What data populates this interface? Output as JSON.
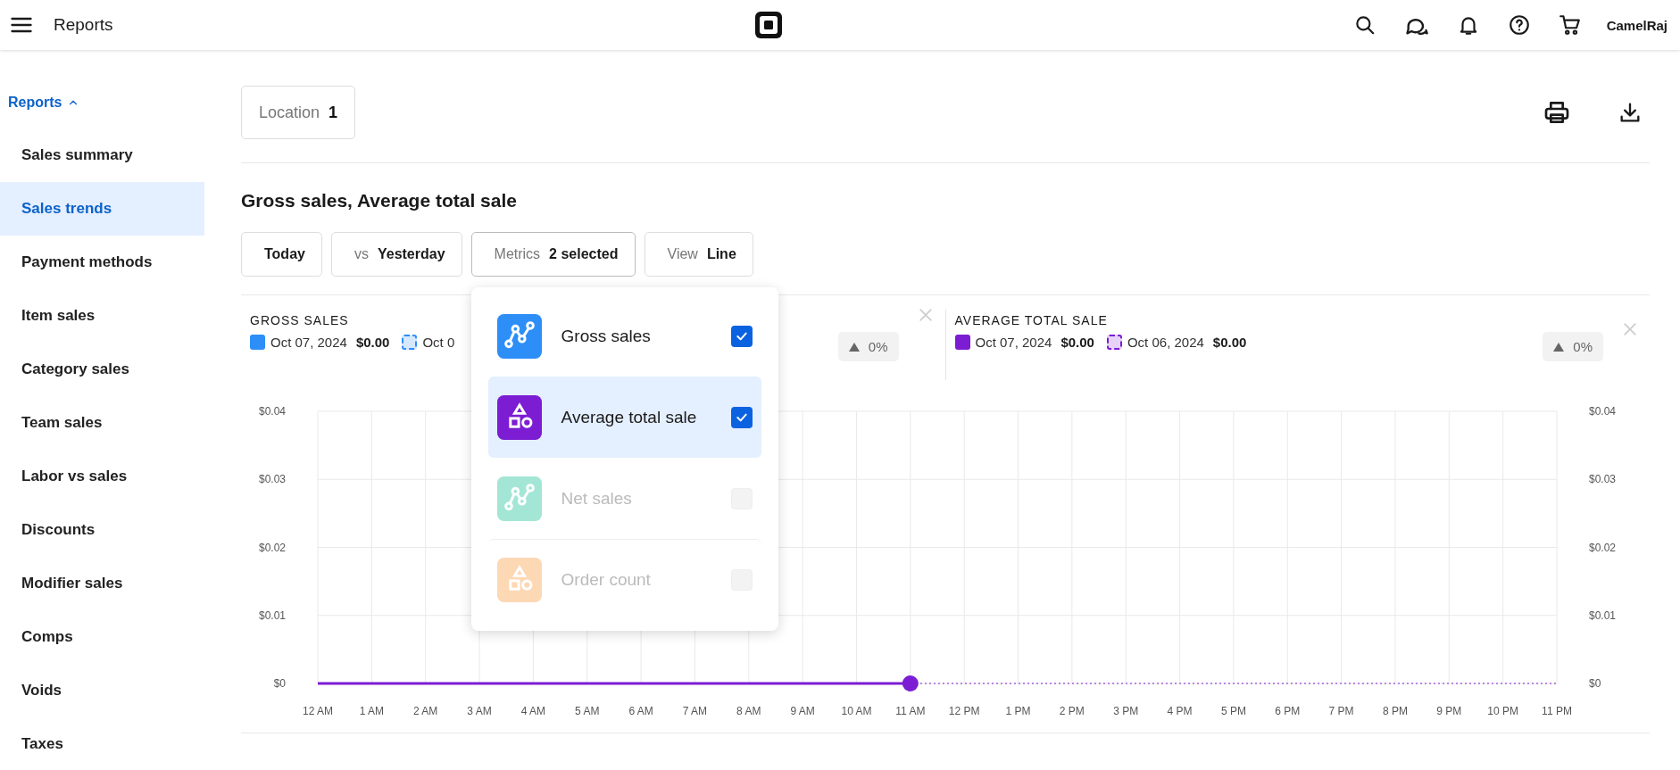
{
  "topbar": {
    "title": "Reports",
    "user": "CamelRaj"
  },
  "sidebar": {
    "section": {
      "label": "Reports",
      "expanded": true
    },
    "items": [
      {
        "label": "Sales summary",
        "selected": false
      },
      {
        "label": "Sales trends",
        "selected": true
      },
      {
        "label": "Payment methods",
        "selected": false
      },
      {
        "label": "Item sales",
        "selected": false
      },
      {
        "label": "Category sales",
        "selected": false
      },
      {
        "label": "Team sales",
        "selected": false
      },
      {
        "label": "Labor vs sales",
        "selected": false
      },
      {
        "label": "Discounts",
        "selected": false
      },
      {
        "label": "Modifier sales",
        "selected": false
      },
      {
        "label": "Comps",
        "selected": false
      },
      {
        "label": "Voids",
        "selected": false
      },
      {
        "label": "Taxes",
        "selected": false
      }
    ]
  },
  "location": {
    "label": "Location",
    "value": "1"
  },
  "report": {
    "title": "Gross sales, Average total sale",
    "filters": [
      {
        "value": "Today",
        "expanded": false
      },
      {
        "label": "vs",
        "value": "Yesterday",
        "expanded": false
      },
      {
        "label": "Metrics",
        "value": "2 selected",
        "expanded": true,
        "menu": [
          {
            "label": "Gross sales",
            "kind": "line",
            "color": "#2d8ef8",
            "checked": true,
            "disabled": false,
            "highlighted": false
          },
          {
            "label": "Average total sale",
            "kind": "shapes",
            "color": "#7c1dd3",
            "checked": true,
            "disabled": false,
            "highlighted": true
          },
          {
            "label": "Net sales",
            "kind": "line",
            "color": "#a3e6d5",
            "checked": false,
            "disabled": true,
            "highlighted": false
          },
          {
            "label": "Order count",
            "kind": "shapes",
            "color": "#fdd8b5",
            "checked": false,
            "disabled": true,
            "highlighted": false
          }
        ]
      },
      {
        "label": "View",
        "value": "Line",
        "expanded": false
      }
    ],
    "metric_cards": [
      {
        "title": "GROSS SALES",
        "color": "#2d8ef8",
        "legend": [
          {
            "kind": "current",
            "date": "Oct 07, 2024",
            "value": "$0.00"
          },
          {
            "kind": "previous",
            "date": "Oct 0"
          }
        ],
        "change": "0%"
      },
      {
        "title": "AVERAGE TOTAL SALE",
        "color": "#7c1dd3",
        "legend": [
          {
            "kind": "current",
            "date": "Oct 07, 2024",
            "value": "$0.00"
          },
          {
            "kind": "previous",
            "date": "Oct 06, 2024",
            "value": "$0.00"
          }
        ],
        "change": "0%"
      }
    ],
    "chart_data": {
      "type": "line",
      "categories": [
        "12 AM",
        "1 AM",
        "2 AM",
        "3 AM",
        "4 AM",
        "5 AM",
        "6 AM",
        "7 AM",
        "8 AM",
        "9 AM",
        "10 AM",
        "11 AM",
        "12 PM",
        "1 PM",
        "2 PM",
        "3 PM",
        "4 PM",
        "5 PM",
        "6 PM",
        "7 PM",
        "8 PM",
        "9 PM",
        "10 PM",
        "11 PM"
      ],
      "series": [
        {
          "color": "#7c1dd3",
          "line_style": "solid",
          "values": [
            0,
            0,
            0,
            0,
            0,
            0,
            0,
            0,
            0,
            0,
            0,
            0,
            null,
            null,
            null,
            null,
            null,
            null,
            null,
            null,
            null,
            null,
            null,
            null
          ]
        },
        {
          "color": "#7c1dd3",
          "line_style": "dashed",
          "values": [
            0,
            0,
            0,
            0,
            0,
            0,
            0,
            0,
            0,
            0,
            0,
            0,
            0,
            0,
            0,
            0,
            0,
            0,
            0,
            0,
            0,
            0,
            0,
            0
          ]
        }
      ],
      "ylim": [
        0,
        0.04
      ],
      "grid": true,
      "yticks": [
        {
          "value": 0,
          "label": "$0"
        },
        {
          "value": 0.01,
          "label": "$0.01"
        },
        {
          "value": 0.02,
          "label": "$0.02"
        },
        {
          "value": 0.03,
          "label": "$0.03"
        },
        {
          "value": 0.04,
          "label": "$0.04"
        }
      ]
    }
  }
}
